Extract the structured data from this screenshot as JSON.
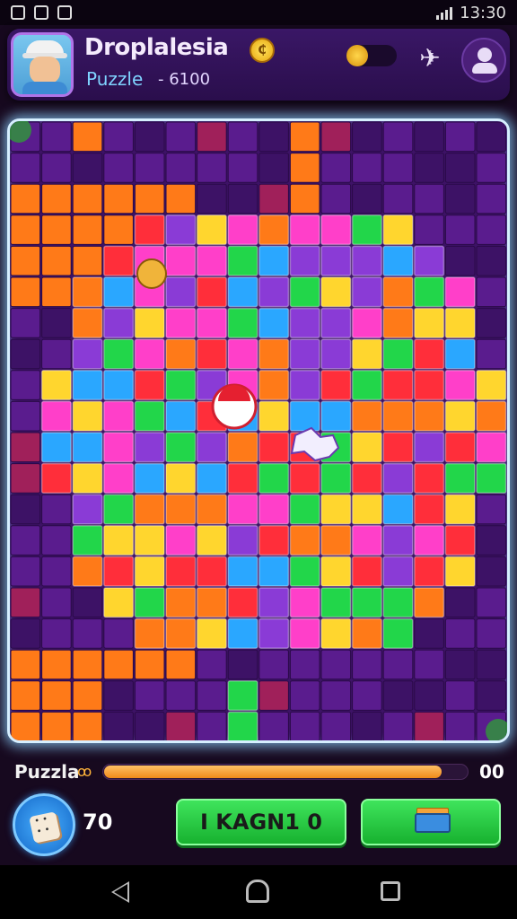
{
  "status_bar": {
    "time": "13:30"
  },
  "header": {
    "title": "Droplalesia",
    "coin_symbol": "₵",
    "puzzle_label": "Puzzle",
    "score": "- 6100"
  },
  "board": {
    "colors": {
      "purple_dark": "#3d1266",
      "purple": "#5a1c8e",
      "orange": "#ff7a18",
      "magenta": "#ff3fc9",
      "yellow": "#ffd62e",
      "green": "#22d64a",
      "blue": "#2aa7ff",
      "red": "#ff2e3a",
      "crimson": "#a0205a",
      "violet": "#8a3bd6"
    }
  },
  "footer": {
    "progress_label": "Puzzla",
    "progress_icon": "ꝏ",
    "progress_fraction": 0.93,
    "progress_value": "00",
    "dice_count": "70",
    "main_button_label": "I KAGN1 0"
  }
}
